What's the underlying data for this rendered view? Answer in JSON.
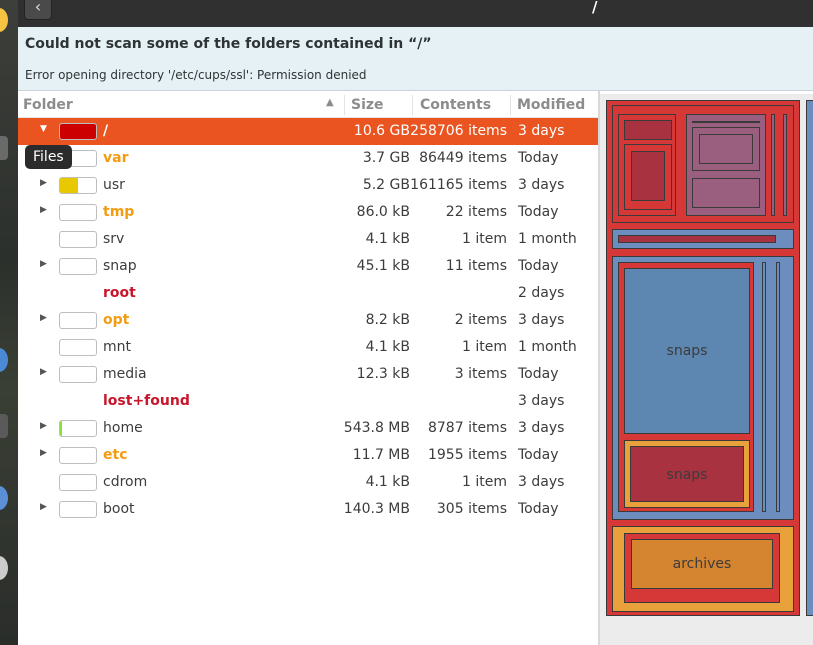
{
  "window": {
    "back_glyph": "‹",
    "path_title": "/"
  },
  "infobar": {
    "headline": "Could not scan some of the folders contained in “/”",
    "detail": "Error opening directory '/etc/cups/ssl': Permission denied"
  },
  "columns": {
    "folder": "Folder",
    "size": "Size",
    "contents": "Contents",
    "modified": "Modified"
  },
  "tooltip": "Files",
  "rows": [
    {
      "name": "/",
      "size": "10.6 GB",
      "contents": "258706 items",
      "modified": "3 days",
      "expander": "▼",
      "style": "selected",
      "swatch_color": "#cc0000",
      "fill_fraction": 1.0
    },
    {
      "name": "var",
      "size": "3.7 GB",
      "contents": "86449 items",
      "modified": "Today",
      "expander": "",
      "style": "warn",
      "swatch_color": "#cc0000",
      "fill_fraction": 0.0
    },
    {
      "name": "usr",
      "size": "5.2 GB",
      "contents": "161165 items",
      "modified": "3 days",
      "expander": "▶",
      "style": "normal",
      "swatch_color": "#e8c800",
      "fill_fraction": 0.49
    },
    {
      "name": "tmp",
      "size": "86.0 kB",
      "contents": "22 items",
      "modified": "Today",
      "expander": "▶",
      "style": "warn",
      "swatch_color": "#e8c800",
      "fill_fraction": 0.0
    },
    {
      "name": "srv",
      "size": "4.1 kB",
      "contents": "1 item",
      "modified": "1 month",
      "expander": "",
      "style": "normal",
      "swatch_color": "#e8c800",
      "fill_fraction": 0.0
    },
    {
      "name": "snap",
      "size": "45.1 kB",
      "contents": "11 items",
      "modified": "Today",
      "expander": "▶",
      "style": "normal",
      "swatch_color": "#e8c800",
      "fill_fraction": 0.0
    },
    {
      "name": "root",
      "size": "",
      "contents": "",
      "modified": "2 days",
      "expander": "",
      "style": "err",
      "swatch_color": "",
      "fill_fraction": 0.0
    },
    {
      "name": "opt",
      "size": "8.2 kB",
      "contents": "2 items",
      "modified": "3 days",
      "expander": "▶",
      "style": "warn",
      "swatch_color": "#e8c800",
      "fill_fraction": 0.0
    },
    {
      "name": "mnt",
      "size": "4.1 kB",
      "contents": "1 item",
      "modified": "1 month",
      "expander": "",
      "style": "normal",
      "swatch_color": "#e8c800",
      "fill_fraction": 0.0
    },
    {
      "name": "media",
      "size": "12.3 kB",
      "contents": "3 items",
      "modified": "Today",
      "expander": "▶",
      "style": "normal",
      "swatch_color": "#e8c800",
      "fill_fraction": 0.0
    },
    {
      "name": "lost+found",
      "size": "",
      "contents": "",
      "modified": "3 days",
      "expander": "",
      "style": "err",
      "swatch_color": "",
      "fill_fraction": 0.0
    },
    {
      "name": "home",
      "size": "543.8 MB",
      "contents": "8787 items",
      "modified": "3 days",
      "expander": "▶",
      "style": "normal",
      "swatch_color": "#8ae234",
      "fill_fraction": 0.05
    },
    {
      "name": "etc",
      "size": "11.7 MB",
      "contents": "1955 items",
      "modified": "Today",
      "expander": "▶",
      "style": "warn",
      "swatch_color": "#8ae234",
      "fill_fraction": 0.0
    },
    {
      "name": "cdrom",
      "size": "4.1 kB",
      "contents": "1 item",
      "modified": "3 days",
      "expander": "",
      "style": "normal",
      "swatch_color": "#8ae234",
      "fill_fraction": 0.0
    },
    {
      "name": "boot",
      "size": "140.3 MB",
      "contents": "305 items",
      "modified": "Today",
      "expander": "▶",
      "style": "normal",
      "swatch_color": "#8ae234",
      "fill_fraction": 0.0
    }
  ],
  "treemap": {
    "labels": {
      "snaps_large": "snaps",
      "snaps_small": "snaps",
      "archives": "archives"
    },
    "colors": {
      "red": "#d63838",
      "darkred": "#a8323f",
      "mauve": "#9a5f7e",
      "blue": "#6c8ebf",
      "steel": "#5d86b0",
      "orange": "#e9a23b",
      "amber": "#d5842f",
      "border": "#3a3a3a"
    }
  },
  "dock": {
    "colors": [
      "#f6c343",
      "#5b8fd6",
      "#4a8ad4",
      "#cccccc"
    ]
  }
}
